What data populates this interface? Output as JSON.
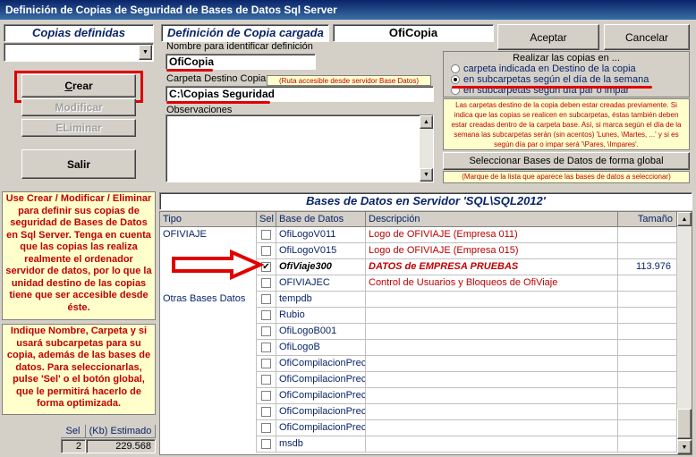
{
  "window": {
    "title": "Definición de Copias de Seguridad de Bases de Datos Sql Server"
  },
  "left": {
    "copias_header": "Copias definidas",
    "buttons": {
      "crear": "Crear",
      "crear_underline": "C",
      "crear_rest": "rear",
      "modificar": "Modificar",
      "eliminar": "ELiminar",
      "salir": "Salir"
    },
    "info1": "Use Crear / Modificar / Eliminar para definir sus copias de seguridad de Bases de Datos en Sql Server. Tenga en cuenta que las copias las realiza realmente el ordenador servidor de datos, por lo que la unidad destino de las copias tiene que ser accesible desde éste.",
    "info2": "Indique Nombre, Carpeta y si usará subcarpetas para su copia, además de las bases de datos. Para seleccionarlas, pulse 'Sel' o el botón global, que le permitirá hacerlo de forma optimizada.",
    "stats": {
      "sel_label": "Sel",
      "kb_label": "(Kb) Estimado",
      "sel_value": "2",
      "kb_value": "229.568"
    }
  },
  "form": {
    "header": "Definición de Copia cargada",
    "loaded_name": "OfiCopia",
    "name_label": "Nombre para identificar definición",
    "name_value": "OfiCopia",
    "folder_label": "Carpeta Destino Copia",
    "folder_hint": "(Ruta accesible desde servidor Base Datos)",
    "folder_value": "C:\\Copias Seguridad",
    "obs_label": "Observaciones",
    "obs_value": ""
  },
  "actions": {
    "aceptar": "Aceptar",
    "cancelar": "Cancelar"
  },
  "options": {
    "title": "Realizar las copias en ...",
    "radios": [
      {
        "label": "carpeta indicada en Destino de la copia",
        "selected": false
      },
      {
        "label": "en subcarpetas según el día de la semana",
        "selected": true
      },
      {
        "label": "en subcarpetas según día par o impar",
        "selected": false
      }
    ],
    "note": "Las carpetas destino de la copia deben estar creadas previamente. Si indica que las copias se realicen en subcarpetas, éstas también deben estar creadas dentro de la carpeta base. Así, si marca según el día de la semana las subcarpetas serán (sin acentos) 'Lunes, \\Martes, ...' y si es según día par o impar será '\\Pares, \\Impares'."
  },
  "global": {
    "button": "Seleccionar Bases de Datos de forma global",
    "hint": "(Marque de la lista que aparece las bases de datos a seleccionar)"
  },
  "grid": {
    "title": "Bases de Datos en Servidor 'SQL\\SQL2012'",
    "columns": [
      "Tipo",
      "Sel",
      "Base de Datos",
      "Descripción",
      "Tamaño"
    ],
    "rows": [
      {
        "tipo": "OFIVIAJE",
        "sel": false,
        "db": "OfiLogoV011",
        "desc": "Logo de OFIVIAJE (Empresa 011)",
        "size": "",
        "style": "red"
      },
      {
        "tipo": "",
        "sel": false,
        "db": "OfiLogoV015",
        "desc": "Logo de OFIVIAJE (Empresa 015)",
        "size": "",
        "style": "red"
      },
      {
        "tipo": "",
        "sel": true,
        "db": "OfiViaje300",
        "desc": "DATOS de EMPRESA PRUEBAS",
        "size": "113.976",
        "style": "redbold"
      },
      {
        "tipo": "",
        "sel": false,
        "db": "OFIVIAJEC",
        "desc": "Control de Usuarios y Bloqueos de OfiViaje",
        "size": "",
        "style": "red"
      },
      {
        "tipo": "Otras Bases Datos",
        "sel": false,
        "db": "tempdb",
        "desc": "",
        "size": "",
        "style": ""
      },
      {
        "tipo": "",
        "sel": false,
        "db": "Rubio",
        "desc": "",
        "size": "",
        "style": ""
      },
      {
        "tipo": "",
        "sel": false,
        "db": "OfiLogoB001",
        "desc": "",
        "size": "",
        "style": ""
      },
      {
        "tipo": "",
        "sel": false,
        "db": "OfiLogoB",
        "desc": "",
        "size": "",
        "style": ""
      },
      {
        "tipo": "",
        "sel": false,
        "db": "OfiCompilacionPrec",
        "desc": "",
        "size": "",
        "style": ""
      },
      {
        "tipo": "",
        "sel": false,
        "db": "OfiCompilacionPrec",
        "desc": "",
        "size": "",
        "style": ""
      },
      {
        "tipo": "",
        "sel": false,
        "db": "OfiCompilacionPrec",
        "desc": "",
        "size": "",
        "style": ""
      },
      {
        "tipo": "",
        "sel": false,
        "db": "OfiCompilacionPrec",
        "desc": "",
        "size": "",
        "style": ""
      },
      {
        "tipo": "",
        "sel": false,
        "db": "OfiCompilacionPrec",
        "desc": "",
        "size": "",
        "style": ""
      },
      {
        "tipo": "",
        "sel": false,
        "db": "msdb",
        "desc": "",
        "size": "",
        "style": ""
      }
    ]
  },
  "colors": {
    "title_bar": "#0a246a",
    "highlight_red": "#e00000",
    "info_bg": "#ffffcc",
    "desc_red": "#c00000"
  }
}
